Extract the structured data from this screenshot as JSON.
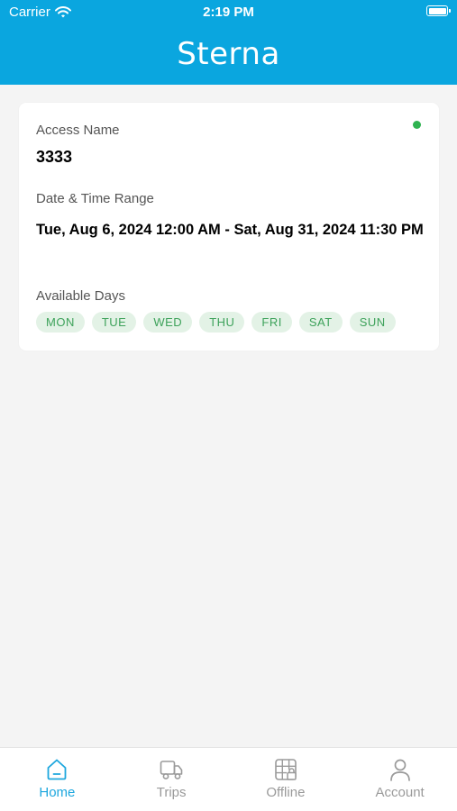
{
  "status_bar": {
    "carrier": "Carrier",
    "time": "2:19 PM"
  },
  "header": {
    "title": "Sterna",
    "color": "#0aa6df"
  },
  "access_card": {
    "status_color": "#2fb350",
    "access_name_label": "Access Name",
    "access_name": "3333",
    "date_range_label": "Date & Time Range",
    "date_range": "Tue, Aug 6, 2024 12:00 AM - Sat, Aug 31, 2024 11:30 PM",
    "available_days_label": "Available Days",
    "available_days": [
      "MON",
      "TUE",
      "WED",
      "THU",
      "FRI",
      "SAT",
      "SUN"
    ]
  },
  "tab_bar": {
    "active": "Home",
    "active_color": "#1ea7de",
    "tabs": [
      {
        "label": "Home",
        "icon": "home-icon"
      },
      {
        "label": "Trips",
        "icon": "truck-icon"
      },
      {
        "label": "Offline",
        "icon": "offline-map-icon"
      },
      {
        "label": "Account",
        "icon": "user-icon"
      }
    ]
  }
}
